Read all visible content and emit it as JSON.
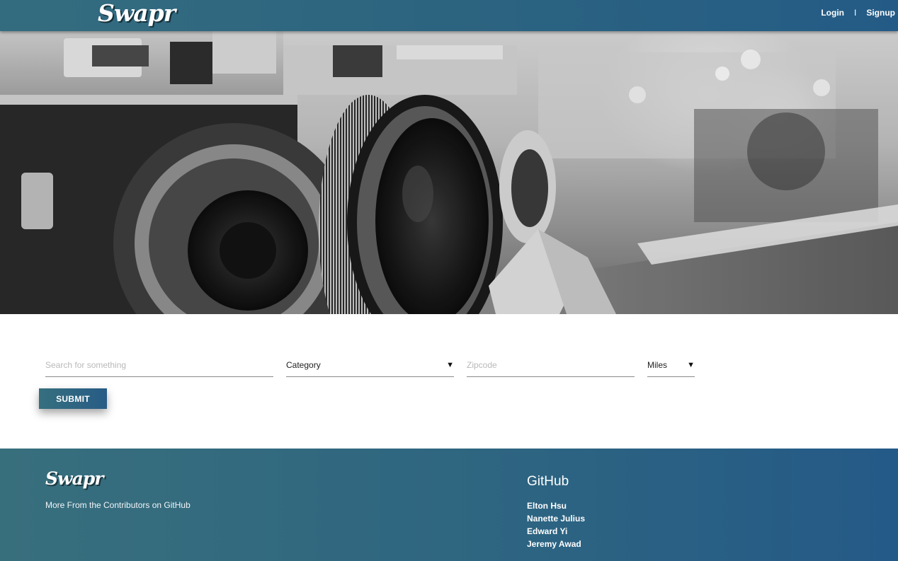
{
  "navbar": {
    "brand": "Swapr",
    "login_label": "Login",
    "separator": "I",
    "signup_label": "Signup"
  },
  "search": {
    "query_placeholder": "Search for something",
    "query_value": "",
    "category_value": "Category",
    "zipcode_placeholder": "Zipcode",
    "zipcode_value": "",
    "miles_value": "Miles",
    "submit_label": "SUBMIT"
  },
  "footer": {
    "brand": "Swapr",
    "tagline": "More From the Contributors on GitHub",
    "github_title": "GitHub",
    "contributors": [
      "Elton Hsu",
      "Nanette Julius",
      "Edward Yi",
      "Jeremy Awad"
    ]
  },
  "colors": {
    "header_gradient_start": "#346c7f",
    "header_gradient_end": "#245b86",
    "accent": "#2c6480"
  },
  "icons": {
    "select_caret": "triangle-down-icon"
  }
}
